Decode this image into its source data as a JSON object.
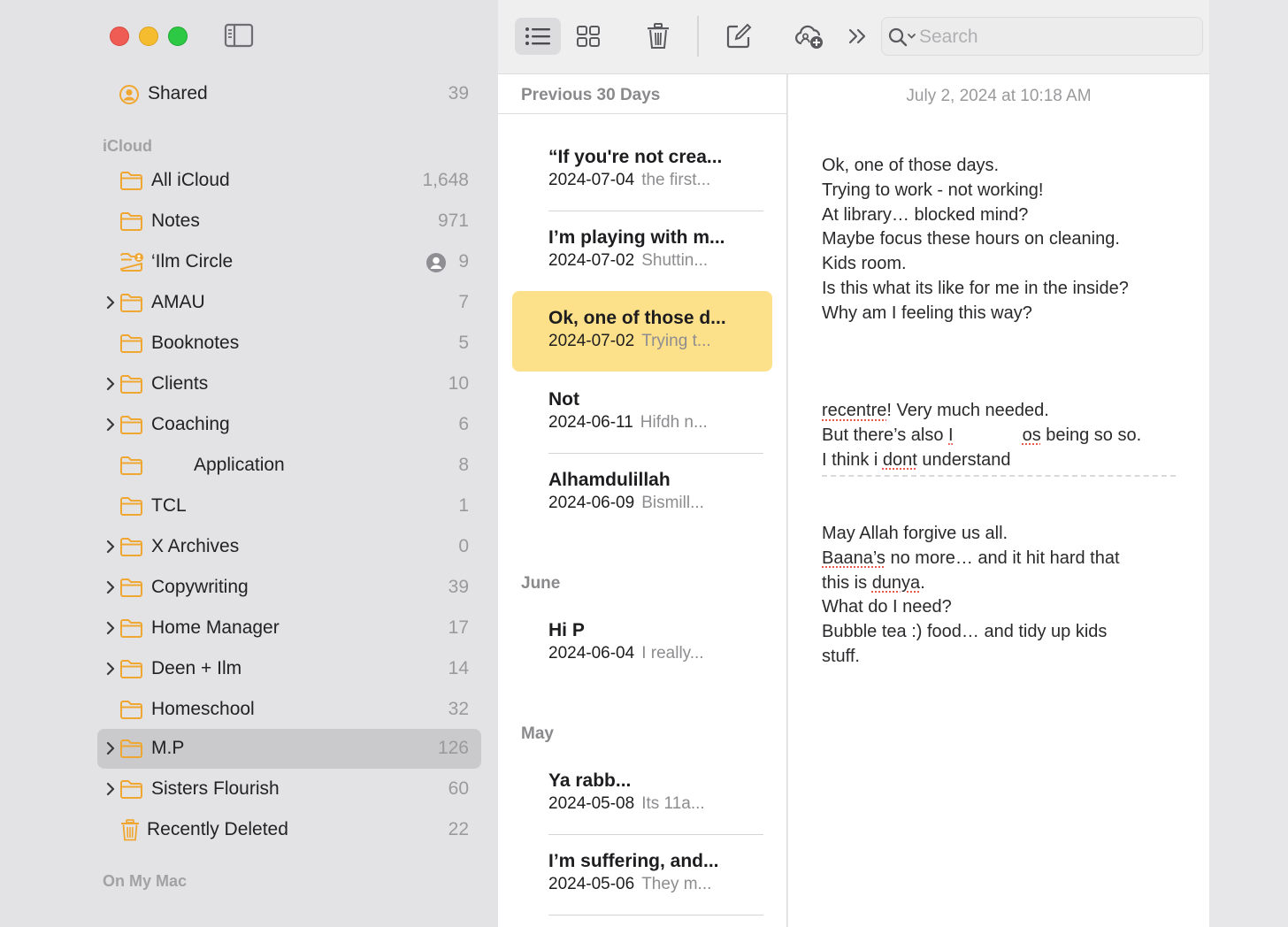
{
  "sidebar": {
    "shared": {
      "label": "Shared",
      "count": "39"
    },
    "icloud_header": "iCloud",
    "folders": [
      {
        "label": "All iCloud",
        "count": "1,648",
        "expandable": false
      },
      {
        "label": "Notes",
        "count": "971",
        "expandable": false
      },
      {
        "label": "‘Ilm Circle",
        "count": "9",
        "expandable": false,
        "shared": true
      },
      {
        "label": "AMAU",
        "count": "7",
        "expandable": true
      },
      {
        "label": "Booknotes",
        "count": "5",
        "expandable": false
      },
      {
        "label": "Clients",
        "count": "10",
        "expandable": true
      },
      {
        "label": "Coaching",
        "count": "6",
        "expandable": true
      },
      {
        "label": "Application",
        "count": "8",
        "expandable": false
      },
      {
        "label": "TCL",
        "count": "1",
        "expandable": false
      },
      {
        "label": "X Archives",
        "count": "0",
        "expandable": true
      },
      {
        "label": "Copywriting",
        "count": "39",
        "expandable": true
      },
      {
        "label": "Home Manager",
        "count": "17",
        "expandable": true
      },
      {
        "label": "Deen + Ilm",
        "count": "14",
        "expandable": true
      },
      {
        "label": "Homeschool",
        "count": "32",
        "expandable": false
      },
      {
        "label": "M.P",
        "count": "126",
        "expandable": true,
        "selected": true
      },
      {
        "label": "Sisters Flourish",
        "count": "60",
        "expandable": true
      },
      {
        "label": "Recently Deleted",
        "count": "22",
        "expandable": false
      }
    ],
    "on_my_mac_header": "On My Mac"
  },
  "toolbar": {
    "search_placeholder": "Search",
    "icons": [
      "list-view-icon",
      "gallery-view-icon",
      "trash-icon",
      "compose-icon",
      "collaborate-icon",
      "more-chevron-icon",
      "search-icon"
    ]
  },
  "note_list": {
    "sections": [
      {
        "header": "Previous 30 Days"
      },
      {
        "header": "June"
      },
      {
        "header": "May"
      }
    ],
    "notes": [
      {
        "title": "“If you're not crea...",
        "date": "2024-07-04",
        "preview": "the first..."
      },
      {
        "title": "I’m playing with m...",
        "date": "2024-07-02",
        "preview": "Shuttin..."
      },
      {
        "title": "Ok, one of those d...",
        "date": "2024-07-02",
        "preview": "Trying t...",
        "selected": true
      },
      {
        "title": "Not",
        "date": "2024-06-11",
        "preview": "Hifdh n..."
      },
      {
        "title": "Alhamdulillah",
        "date": "2024-06-09",
        "preview": "Bismill..."
      },
      {
        "title": "Hi P",
        "date": "2024-06-04",
        "preview": "I really..."
      },
      {
        "title": "Ya rabb...",
        "date": "2024-05-08",
        "preview": "Its 11a..."
      },
      {
        "title": "I’m suffering, and...",
        "date": "2024-05-06",
        "preview": "They m..."
      }
    ]
  },
  "note_detail": {
    "date": "July 2, 2024 at 10:18 AM",
    "lines_1": [
      "Ok, one of those days.",
      "Trying to work - not working!",
      "At library… blocked mind?",
      "Maybe focus these hours on cleaning.",
      "Kids room.",
      "Is this what its like for me in the inside?",
      "Why am I feeling this way?"
    ],
    "line_2a_word": "recentre",
    "line_2a_rest": "! Very much needed.",
    "line_2b_start": "But there’s also ",
    "line_2b_i": "I",
    "line_2b_os": "os",
    "line_2b_end": " being so so.",
    "line_2c_start": "I think i ",
    "line_2c_word": "dont",
    "line_2c_end": " understand",
    "line_3a": "May Allah forgive us all.",
    "line_3b_word": "Baana’s",
    "line_3b_rest": " no more… and it hit hard that",
    "line_3c_start": "this is ",
    "line_3c_word": "dunya",
    "line_3c_end": ".",
    "line_3d": "What do I need?",
    "line_3e": "Bubble tea :) food… and tidy up kids",
    "line_3f": "stuff."
  },
  "colors": {
    "folder_accent": "#f0a732",
    "selected_note": "#fde08a",
    "sidebar_selected": "#cacacc",
    "close": "#ee5c53",
    "minimize": "#f6bc2f",
    "maximize": "#2dc844",
    "spelling_underline": "#e85a4f"
  }
}
